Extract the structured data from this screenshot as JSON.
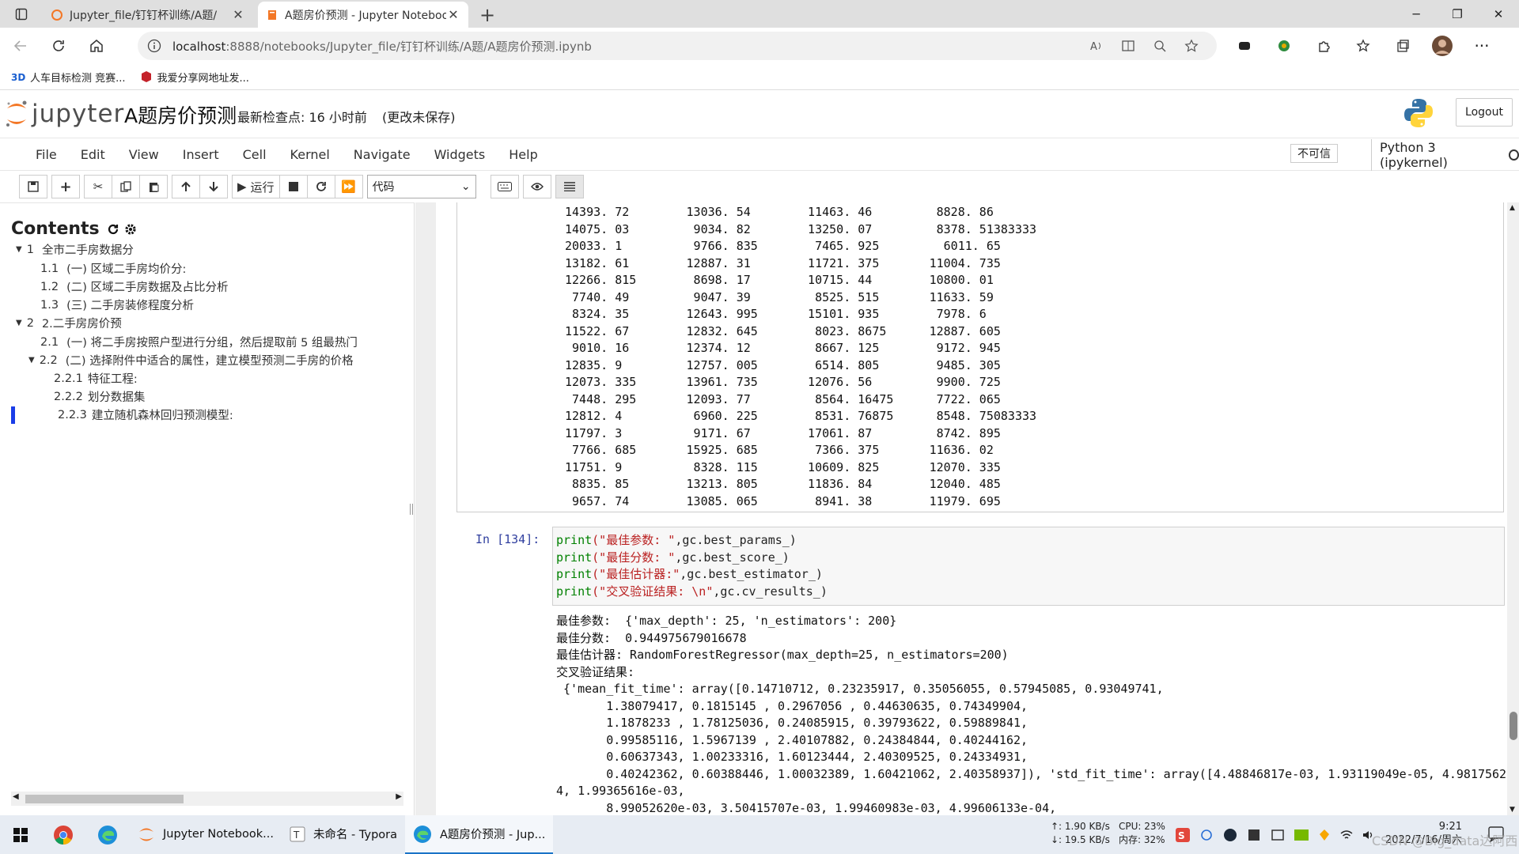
{
  "browser": {
    "tabs": [
      {
        "title": "Jupyter_file/钉钉杯训练/A题/",
        "close": "✕"
      },
      {
        "title": "A题房价预测 - Jupyter Notebook",
        "close": "✕"
      }
    ],
    "new_tab": "+",
    "url_host": "localhost",
    "url_path": ":8888/notebooks/Jupyter_file/钉钉杯训练/A题/A题房价预测.ipynb",
    "bookmarks": [
      {
        "label": "人车目标检测 竞赛..."
      },
      {
        "label": "我爱分享网地址发..."
      }
    ]
  },
  "jupyter": {
    "logo_text": "jupyter",
    "notebook_title": "A题房价预测",
    "checkpoint": "最新检查点: 16 小时前",
    "unsaved": "(更改未保存)",
    "logout": "Logout",
    "menus": [
      "File",
      "Edit",
      "View",
      "Insert",
      "Cell",
      "Kernel",
      "Navigate",
      "Widgets",
      "Help"
    ],
    "trusted": "不可信",
    "kernel": "Python 3 (ipykernel)",
    "toolbar": {
      "run_label": "运行",
      "cell_type": "代码"
    }
  },
  "toc": {
    "title": "Contents",
    "items": [
      {
        "num": "1",
        "label": "全市二手房数据分"
      },
      {
        "num": "1.1",
        "label": "(一) 区域二手房均价分:"
      },
      {
        "num": "1.2",
        "label": "(二) 区域二手房数据及占比分析"
      },
      {
        "num": "1.3",
        "label": "(三) 二手房装修程度分析"
      },
      {
        "num": "2",
        "label": "2.二手房房价预"
      },
      {
        "num": "2.1",
        "label": "(一) 将二手房按照户型进行分组，然后提取前 5 组最热门"
      },
      {
        "num": "2.2",
        "label": "(二) 选择附件中适合的属性，建立模型预测二手房的价格"
      },
      {
        "num": "2.2.1",
        "label": "特征工程:"
      },
      {
        "num": "2.2.2",
        "label": "划分数据集"
      },
      {
        "num": "2.2.3",
        "label": "建立随机森林回归预测模型:"
      }
    ]
  },
  "notebook": {
    "table_output": "14393. 72        13036. 54        11463. 46         8828. 86\n14075. 03         9034. 82        13250. 07         8378. 51383333\n20033. 1          9766. 835        7465. 925         6011. 65\n13182. 61        12887. 31        11721. 375       11004. 735\n12266. 815        8698. 17        10715. 44        10800. 01\n 7740. 49         9047. 39         8525. 515       11633. 59\n 8324. 35        12643. 995       15101. 935        7978. 6\n11522. 67        12832. 645        8023. 8675      12887. 605\n 9010. 16        12374. 12         8667. 125        9172. 945\n12835. 9         12757. 005        6514. 805        9485. 305\n12073. 335       13961. 735       12076. 56         9900. 725\n 7448. 295       12093. 77         8564. 16475      7722. 065\n12812. 4          6960. 225        8531. 76875      8548. 75083333\n11797. 3          9171. 67        17061. 87         8742. 895\n 7766. 685       15925. 685        7366. 375       11636. 02\n11751. 9          8328. 115       10609. 825       12070. 335\n 8835. 85        13213. 805       11836. 84        12040. 485\n 9657. 74        13085. 065        8941. 38        11979. 695",
    "cell_prompt": "In  [134]:",
    "code_lines": [
      {
        "fn": "print",
        "str": "(\"最佳参数: \"",
        "rest": ",gc.best_params_)"
      },
      {
        "fn": "print",
        "str": "(\"最佳分数: \"",
        "rest": ",gc.best_score_)"
      },
      {
        "fn": "print",
        "str": "(\"最佳估计器:\"",
        "rest": ",gc.best_estimator_)"
      },
      {
        "fn": "print",
        "str": "(\"交叉验证结果: \\n\"",
        "rest": ",gc.cv_results_)"
      }
    ],
    "result_output": "最佳参数:  {'max_depth': 25, 'n_estimators': 200}\n最佳分数:  0.944975679016678\n最佳估计器: RandomForestRegressor(max_depth=25, n_estimators=200)\n交叉验证结果:\n {'mean_fit_time': array([0.14710712, 0.23235917, 0.35056055, 0.57945085, 0.93049741,\n       1.38079417, 0.1815145 , 0.2967056 , 0.44630635, 0.74349904,\n       1.1878233 , 1.78125036, 0.24085915, 0.39793622, 0.59889841,\n       0.99585116, 1.5967139 , 2.40107882, 0.24384844, 0.40244162,\n       0.60637343, 1.00233316, 1.60123444, 2.40309525, 0.24334931,\n       0.40242362, 0.60388446, 1.00032389, 1.60421062, 2.40358937]), 'std_fit_time': array([4.48846817e-03, 1.93119049e-05, 4.9817562\n4, 1.99365616e-03,\n       8.99052620e-03, 3.50415707e-03, 1.99460983e-03, 4.99606133e-04,"
  },
  "taskbar": {
    "apps": [
      {
        "label": "Jupyter Notebook..."
      },
      {
        "label": "未命名 - Typora"
      },
      {
        "label": "A题房价预测 - Jup..."
      }
    ],
    "net_up": "↑: 1.90 KB/s",
    "net_down": "↓: 19.5 KB/s",
    "cpu": "CPU: 23%",
    "mem": "内存: 32%",
    "time": "9:21",
    "date": "2022/7/16/周六",
    "watermark": "CSDN @Big_data达阿西"
  }
}
